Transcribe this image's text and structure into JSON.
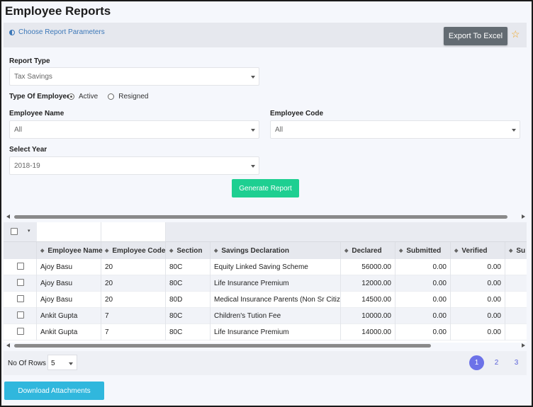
{
  "page": {
    "title": "Employee Reports"
  },
  "params": {
    "link_label": "Choose Report Parameters",
    "export_label": "Export To Excel",
    "favorite_icon": "star-icon",
    "report_type": {
      "label": "Report Type",
      "value": "Tax Savings"
    },
    "employee_type": {
      "label": "Type Of Employees",
      "options": [
        "Active",
        "Resigned"
      ],
      "selected": "Active"
    },
    "employee_name": {
      "label": "Employee Name",
      "value": "All"
    },
    "employee_code": {
      "label": "Employee Code",
      "value": "All"
    },
    "year": {
      "label": "Select Year",
      "value": "2018-19"
    },
    "generate_label": "Generate Report"
  },
  "grid": {
    "columns": [
      "Employee Name",
      "Employee Code",
      "Section",
      "Savings Declaration",
      "Declared",
      "Submitted",
      "Verified",
      "Su"
    ],
    "rows": [
      [
        "Ajoy Basu",
        "20",
        "80C",
        "Equity Linked Saving Scheme",
        "56000.00",
        "0.00",
        "0.00"
      ],
      [
        "Ajoy Basu",
        "20",
        "80C",
        "Life Insurance Premium",
        "12000.00",
        "0.00",
        "0.00"
      ],
      [
        "Ajoy Basu",
        "20",
        "80D",
        "Medical Insurance Parents (Non Sr Citizen)",
        "14500.00",
        "0.00",
        "0.00"
      ],
      [
        "Ankit Gupta",
        "7",
        "80C",
        "Children's Tution Fee",
        "10000.00",
        "0.00",
        "0.00"
      ],
      [
        "Ankit Gupta",
        "7",
        "80C",
        "Life Insurance Premium",
        "14000.00",
        "0.00",
        "0.00"
      ]
    ]
  },
  "footer": {
    "rows_label": "No Of Rows :",
    "rows_value": "5",
    "pages": [
      "1",
      "2",
      "3"
    ],
    "active_page": "1"
  },
  "download_label": "Download Attachments",
  "colors": {
    "export": "#636b72",
    "generate": "#1ecf91",
    "download": "#30b7dd",
    "page_active": "#6c72e8",
    "star": "#f0a51f"
  }
}
